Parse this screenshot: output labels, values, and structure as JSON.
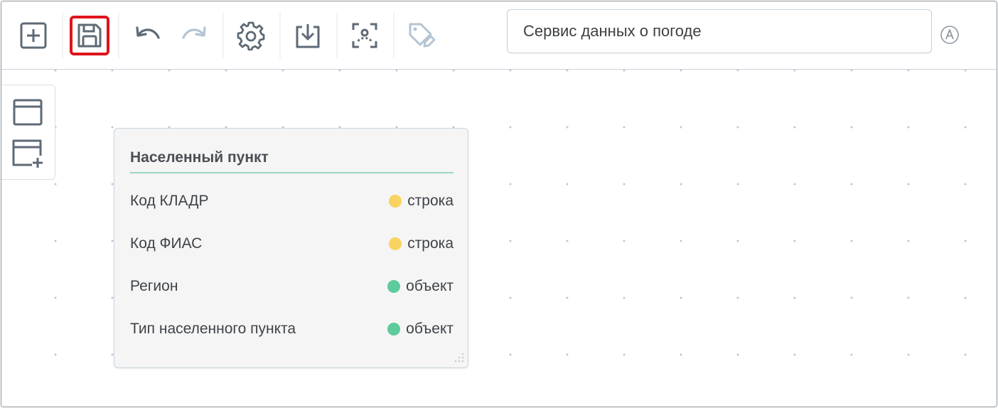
{
  "toolbar": {
    "buttons": [
      {
        "name": "add-button",
        "icon": "plus-square-icon"
      },
      {
        "name": "save-button",
        "icon": "floppy-disk-icon",
        "active": true
      },
      {
        "name": "undo-button",
        "icon": "undo-icon"
      },
      {
        "name": "redo-button",
        "icon": "redo-icon",
        "disabled": true
      },
      {
        "name": "settings-button",
        "icon": "gear-icon"
      },
      {
        "name": "download-button",
        "icon": "download-icon"
      },
      {
        "name": "focus-button",
        "icon": "focus-scan-icon"
      },
      {
        "name": "tag-edit-button",
        "icon": "tag-edit-icon",
        "disabled": true
      }
    ],
    "title_value": "Сервис данных о погоде",
    "autosave_icon": "circle-a-icon"
  },
  "side_panel": {
    "items": [
      {
        "name": "window-icon"
      },
      {
        "name": "window-add-icon"
      }
    ]
  },
  "entity": {
    "title": "Населенный пункт",
    "fields": [
      {
        "name": "Код КЛАДР",
        "type": "строка",
        "color": "#f9d35f"
      },
      {
        "name": "Код ФИАС",
        "type": "строка",
        "color": "#f9d35f"
      },
      {
        "name": "Регион",
        "type": "объект",
        "color": "#5dcb9b"
      },
      {
        "name": "Тип населенного пункта",
        "type": "объект",
        "color": "#5dcb9b"
      }
    ]
  },
  "colors": {
    "accent_active": "#e0131c",
    "icon": "#5e6a75",
    "icon_disabled": "#b4c4d2",
    "divider": "#9ad7c0"
  }
}
